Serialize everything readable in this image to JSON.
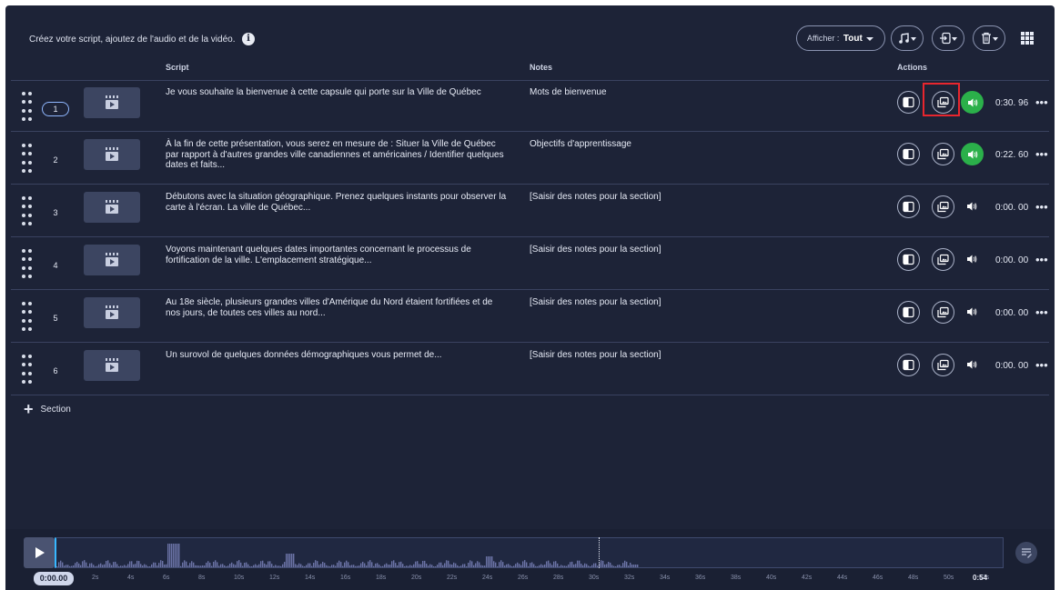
{
  "header": {
    "title": "Créez votre script, ajoutez de l'audio et de la vidéo.",
    "filter_label": "Afficher :",
    "filter_value": "Tout",
    "icons": [
      "music-icon",
      "import-icon",
      "trash-icon",
      "apps-grid-icon"
    ]
  },
  "columns": {
    "script": "Script",
    "notes": "Notes",
    "actions": "Actions"
  },
  "sections": [
    {
      "num": "1",
      "script": "Je vous souhaite la bienvenue à cette capsule qui porte sur la Ville de Québec",
      "notes": "Mots de bienvenue",
      "duration": "0:30. 96",
      "audio": true,
      "selected": true
    },
    {
      "num": "2",
      "script": "À la fin de cette présentation, vous serez en mesure de : Situer la Ville de Québec par rapport à d'autres grandes ville canadiennes et américaines / Identifier quelques dates et faits...",
      "notes": "Objectifs d'apprentissage",
      "duration": "0:22. 60",
      "audio": true,
      "selected": false
    },
    {
      "num": "3",
      "script": "Débutons avec la situation géographique. Prenez quelques instants pour observer la carte à l'écran. La ville de Québec...",
      "notes": "[Saisir des notes pour la section]",
      "duration": "0:00. 00",
      "audio": false,
      "selected": false
    },
    {
      "num": "4",
      "script": "Voyons maintenant quelques dates importantes concernant le processus de fortification de la ville. L'emplacement stratégique...",
      "notes": "[Saisir des notes pour la section]",
      "duration": "0:00. 00",
      "audio": false,
      "selected": false
    },
    {
      "num": "5",
      "script": "Au 18e siècle, plusieurs grandes villes d'Amérique du Nord étaient fortifiées et de nos jours, de toutes ces villes au nord...",
      "notes": "[Saisir des notes pour la section]",
      "duration": "0:00. 00",
      "audio": false,
      "selected": false
    },
    {
      "num": "6",
      "script": "Un surovol de quelques données démographiques vous permet de...",
      "notes": "[Saisir des notes pour la section]",
      "duration": "0:00. 00",
      "audio": false,
      "selected": false
    }
  ],
  "add_section": {
    "plus": "+",
    "label": "Section"
  },
  "timeline": {
    "current_time": "0:00.00",
    "end_label": "0:54",
    "ticks": [
      "2s",
      "4s",
      "6s",
      "8s",
      "10s",
      "12s",
      "14s",
      "16s",
      "18s",
      "20s",
      "22s",
      "24s",
      "26s",
      "28s",
      "30s",
      "32s",
      "34s",
      "36s",
      "38s",
      "40s",
      "42s",
      "44s",
      "46s",
      "48s",
      "50s",
      "52s"
    ]
  }
}
